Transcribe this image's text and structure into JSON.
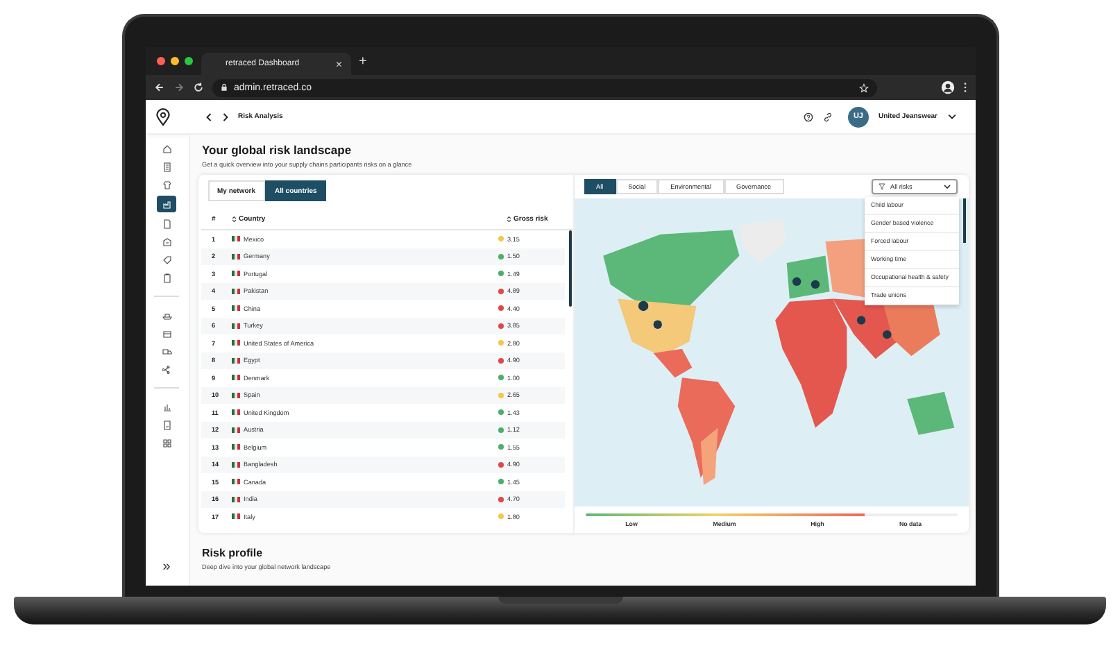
{
  "browser": {
    "tab_title": "retraced Dashboard",
    "tab_close": "×",
    "new_tab": "+",
    "url": "admin.retraced.co"
  },
  "header": {
    "breadcrumb": "Risk Analysis",
    "avatar_initials": "UJ",
    "account": "United Jeanswear"
  },
  "sidebar": {
    "items": [
      {
        "selected": false
      },
      {
        "selected": false
      },
      {
        "selected": false
      },
      {
        "selected": true
      },
      {
        "selected": false
      },
      {
        "selected": false
      },
      {
        "selected": false
      },
      {
        "selected": false
      },
      {
        "selected": false
      },
      {
        "selected": false
      },
      {
        "selected": false
      },
      {
        "selected": false
      },
      {
        "selected": false
      },
      {
        "selected": false
      },
      {
        "selected": false
      }
    ],
    "collapse": "»"
  },
  "section": {
    "title": "Your global risk landscape",
    "subtitle": "Get a quick overview into your supply chains participants risks on a glance"
  },
  "scope_tabs": [
    {
      "label": "My network",
      "selected": false
    },
    {
      "label": "All countries",
      "selected": true
    }
  ],
  "table": {
    "columns": [
      "#",
      "Country",
      "Gross risk"
    ],
    "rows": [
      {
        "rank": "1",
        "country": "Mexico",
        "risk": "3.15",
        "color": "#f2c94c"
      },
      {
        "rank": "2",
        "country": "Germany",
        "risk": "1.50",
        "color": "#4caf6a"
      },
      {
        "rank": "3",
        "country": "Portugal",
        "risk": "1.49",
        "color": "#4caf6a"
      },
      {
        "rank": "4",
        "country": "Pakistan",
        "risk": "4.89",
        "color": "#e04848"
      },
      {
        "rank": "5",
        "country": "China",
        "risk": "4.40",
        "color": "#e04848"
      },
      {
        "rank": "6",
        "country": "Turkey",
        "risk": "3.85",
        "color": "#e04848"
      },
      {
        "rank": "7",
        "country": "United States of America",
        "risk": "2.80",
        "color": "#f2c94c"
      },
      {
        "rank": "8",
        "country": "Egypt",
        "risk": "4.90",
        "color": "#e04848"
      },
      {
        "rank": "9",
        "country": "Denmark",
        "risk": "1.00",
        "color": "#4caf6a"
      },
      {
        "rank": "10",
        "country": "Spain",
        "risk": "2.65",
        "color": "#f2c94c"
      },
      {
        "rank": "11",
        "country": "United Kingdom",
        "risk": "1.43",
        "color": "#4caf6a"
      },
      {
        "rank": "12",
        "country": "Austria",
        "risk": "1.12",
        "color": "#4caf6a"
      },
      {
        "rank": "13",
        "country": "Belgium",
        "risk": "1.55",
        "color": "#4caf6a"
      },
      {
        "rank": "14",
        "country": "Bangladesh",
        "risk": "4.90",
        "color": "#e04848"
      },
      {
        "rank": "15",
        "country": "Canada",
        "risk": "1.45",
        "color": "#4caf6a"
      },
      {
        "rank": "16",
        "country": "India",
        "risk": "4.70",
        "color": "#e04848"
      },
      {
        "rank": "17",
        "country": "Italy",
        "risk": "1.80",
        "color": "#f2c94c"
      }
    ]
  },
  "risk_tabs": [
    {
      "label": "All",
      "selected": true
    },
    {
      "label": "Social",
      "selected": false
    },
    {
      "label": "Environmental",
      "selected": false
    },
    {
      "label": "Governance",
      "selected": false
    }
  ],
  "risk_filter": {
    "value": "All risks",
    "expanded": true,
    "options": [
      "Child labour",
      "Gender based violence",
      "Forced labour",
      "Working time",
      "Occupational health & safety",
      "Trade unions"
    ]
  },
  "legend": [
    "Low",
    "Medium",
    "High",
    "No data"
  ],
  "profile": {
    "title": "Risk profile",
    "subtitle": "Deep dive into your global network landscape"
  }
}
